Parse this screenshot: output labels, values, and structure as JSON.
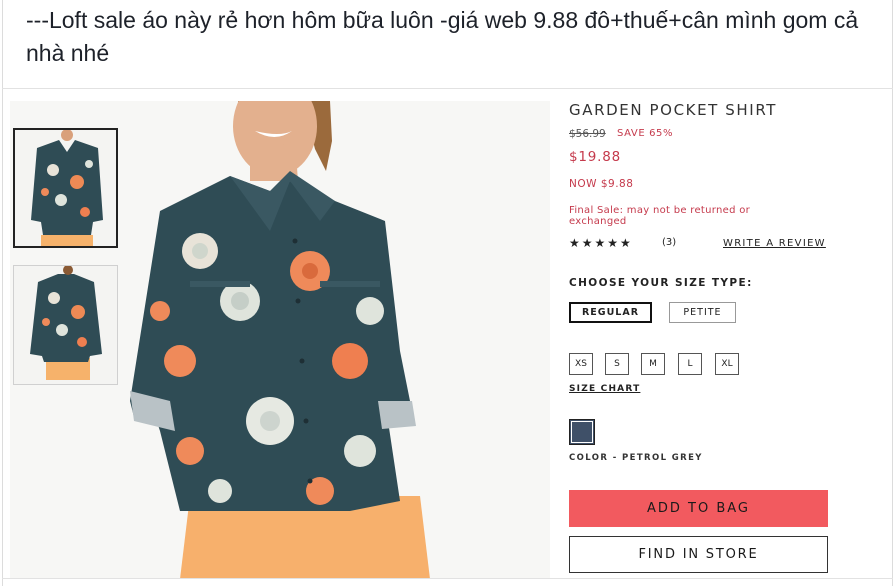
{
  "post": {
    "text": "---Loft sale áo này rẻ hơn hôm bữa luôn -giá web 9.88 đô+thuế+cân mình gom cả nhà nhé"
  },
  "product": {
    "title": "GARDEN POCKET SHIRT",
    "old_price": "$56.99",
    "save": "SAVE 65%",
    "price": "$19.88",
    "now": "NOW $9.88",
    "final_sale": "Final Sale: may not be returned or exchanged",
    "stars": "★★★★★",
    "review_count": "(3)",
    "write_review": "WRITE A REVIEW",
    "size_type_label": "CHOOSE YOUR SIZE TYPE:",
    "size_types": [
      "REGULAR",
      "PETITE"
    ],
    "sizes": [
      "XS",
      "S",
      "M",
      "L",
      "XL"
    ],
    "size_chart": "SIZE CHART",
    "color_label": "COLOR - PETROL GREY",
    "swatch_color": "#3f5068",
    "add_to_bag": "ADD TO BAG",
    "find_in_store": "FIND IN STORE",
    "accent_color": "#f25a5f"
  }
}
